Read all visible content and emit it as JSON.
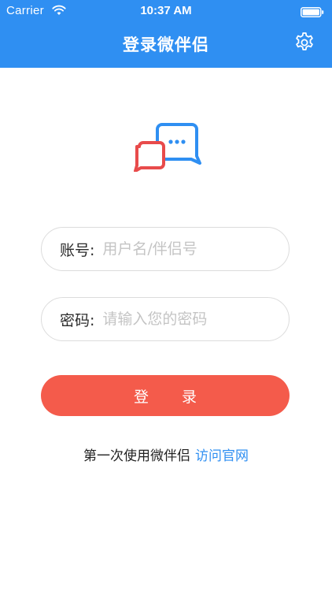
{
  "status_bar": {
    "carrier": "Carrier",
    "time": "10:37 AM"
  },
  "header": {
    "title": "登录微伴侣",
    "settings_icon": "gear-icon"
  },
  "logo": {
    "icon": "chat-bubbles-logo"
  },
  "form": {
    "account": {
      "label": "账号:",
      "placeholder": "用户名/伴侣号",
      "value": ""
    },
    "password": {
      "label": "密码:",
      "placeholder": "请输入您的密码",
      "value": ""
    },
    "login_button_label": "登 录"
  },
  "footer": {
    "text": "第一次使用微伴侣",
    "link_label": "访问官网"
  },
  "colors": {
    "header_bg": "#2f8ff2",
    "primary_button": "#f45b4b",
    "link": "#2f8ff2",
    "logo_blue": "#2f8ff2",
    "logo_red": "#e84b4b"
  }
}
